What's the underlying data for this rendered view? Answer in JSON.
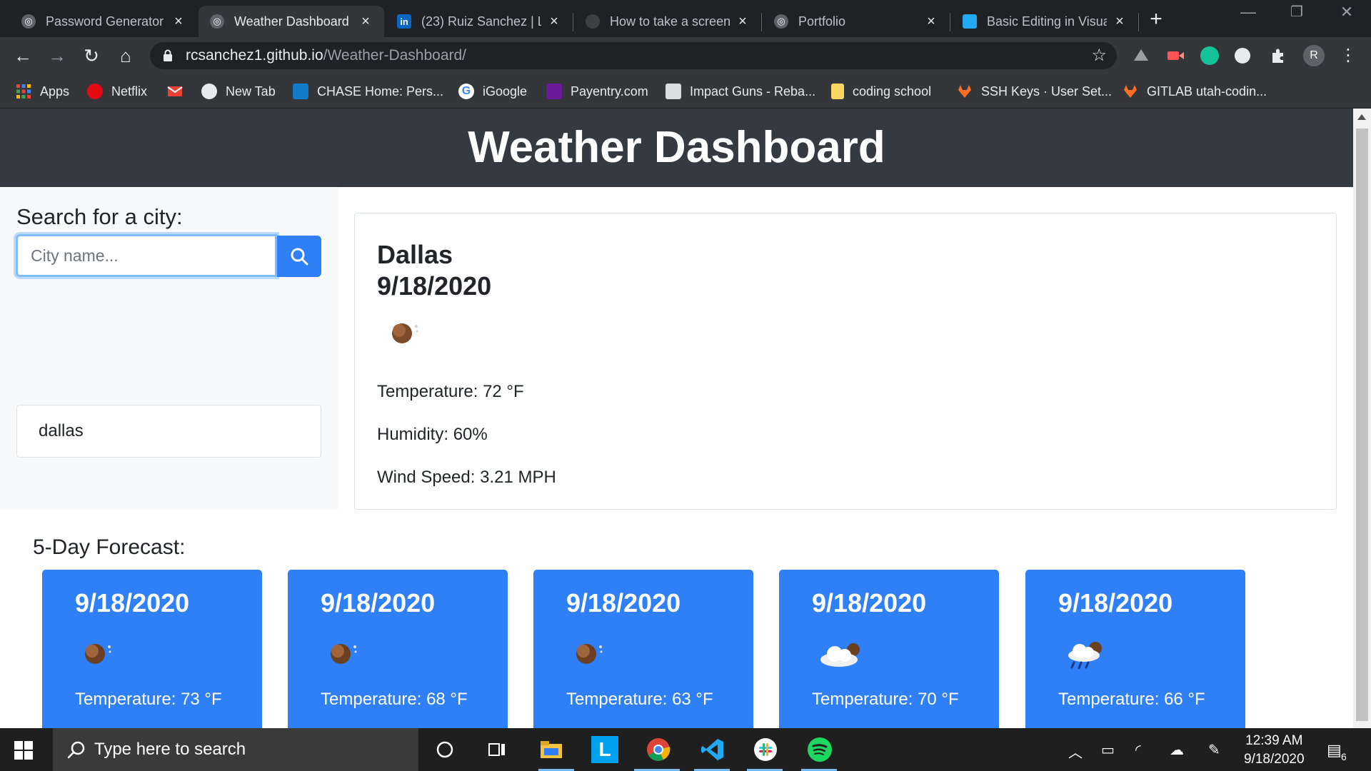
{
  "browser": {
    "tabs": [
      {
        "title": "Password Generator",
        "icon": "globe-icon",
        "active": false
      },
      {
        "title": "Weather Dashboard",
        "icon": "globe-icon",
        "active": true
      },
      {
        "title": "(23) Ruiz Sanchez | Li",
        "icon": "linkedin-icon",
        "active": false
      },
      {
        "title": "How to take a screen",
        "icon": "page-icon",
        "active": false
      },
      {
        "title": "Portfolio",
        "icon": "globe-icon",
        "active": false
      },
      {
        "title": "Basic Editing in Visua",
        "icon": "vscode-icon",
        "active": false
      }
    ],
    "url_host": "rcsanchez1.github.io",
    "url_path": "/Weather-Dashboard/",
    "profile_initial": "R",
    "bookmarks": [
      {
        "label": "Apps",
        "icon": "apps-grid-icon"
      },
      {
        "label": "Netflix",
        "icon": "netflix-icon"
      },
      {
        "label": "",
        "icon": "gmail-icon"
      },
      {
        "label": "New Tab",
        "icon": "globe-icon"
      },
      {
        "label": "CHASE Home: Pers...",
        "icon": "chase-icon"
      },
      {
        "label": "iGoogle",
        "icon": "google-icon"
      },
      {
        "label": "Payentry.com",
        "icon": "payentry-icon"
      },
      {
        "label": "Impact Guns - Reba...",
        "icon": "impactguns-icon"
      },
      {
        "label": "coding school",
        "icon": "folder-icon"
      },
      {
        "label": "SSH Keys · User Set...",
        "icon": "gitlab-icon"
      },
      {
        "label": "GITLAB utah-codin...",
        "icon": "gitlab-icon"
      }
    ]
  },
  "app": {
    "title": "Weather Dashboard",
    "search_heading": "Search for a city:",
    "search_placeholder": "City name...",
    "search_value": "",
    "history": [
      "dallas"
    ],
    "current": {
      "city": "Dallas",
      "date": "9/18/2020",
      "icon": "clear-night-icon",
      "temperature": "Temperature: 72 °F",
      "humidity": "Humidity: 60%",
      "wind": "Wind Speed: 3.21 MPH"
    },
    "forecast_heading": "5-Day Forecast:",
    "forecast": [
      {
        "date": "9/18/2020",
        "icon": "clear-night-icon",
        "temp": "Temperature: 73 °F"
      },
      {
        "date": "9/18/2020",
        "icon": "clear-night-icon",
        "temp": "Temperature: 68 °F"
      },
      {
        "date": "9/18/2020",
        "icon": "clear-night-icon",
        "temp": "Temperature: 63 °F"
      },
      {
        "date": "9/18/2020",
        "icon": "cloudy-night-icon",
        "temp": "Temperature: 70 °F"
      },
      {
        "date": "9/18/2020",
        "icon": "rain-night-icon",
        "temp": "Temperature: 66 °F"
      }
    ]
  },
  "taskbar": {
    "search_placeholder": "Type here to search",
    "time": "12:39 AM",
    "date": "9/18/2020",
    "notification_count": "6"
  },
  "colors": {
    "header_bg": "#343a40",
    "accent_blue": "#2f7ff6",
    "sidebar_bg": "#f8f9fa",
    "chrome_dark": "#202124",
    "chrome_toolbar": "#35363a"
  }
}
